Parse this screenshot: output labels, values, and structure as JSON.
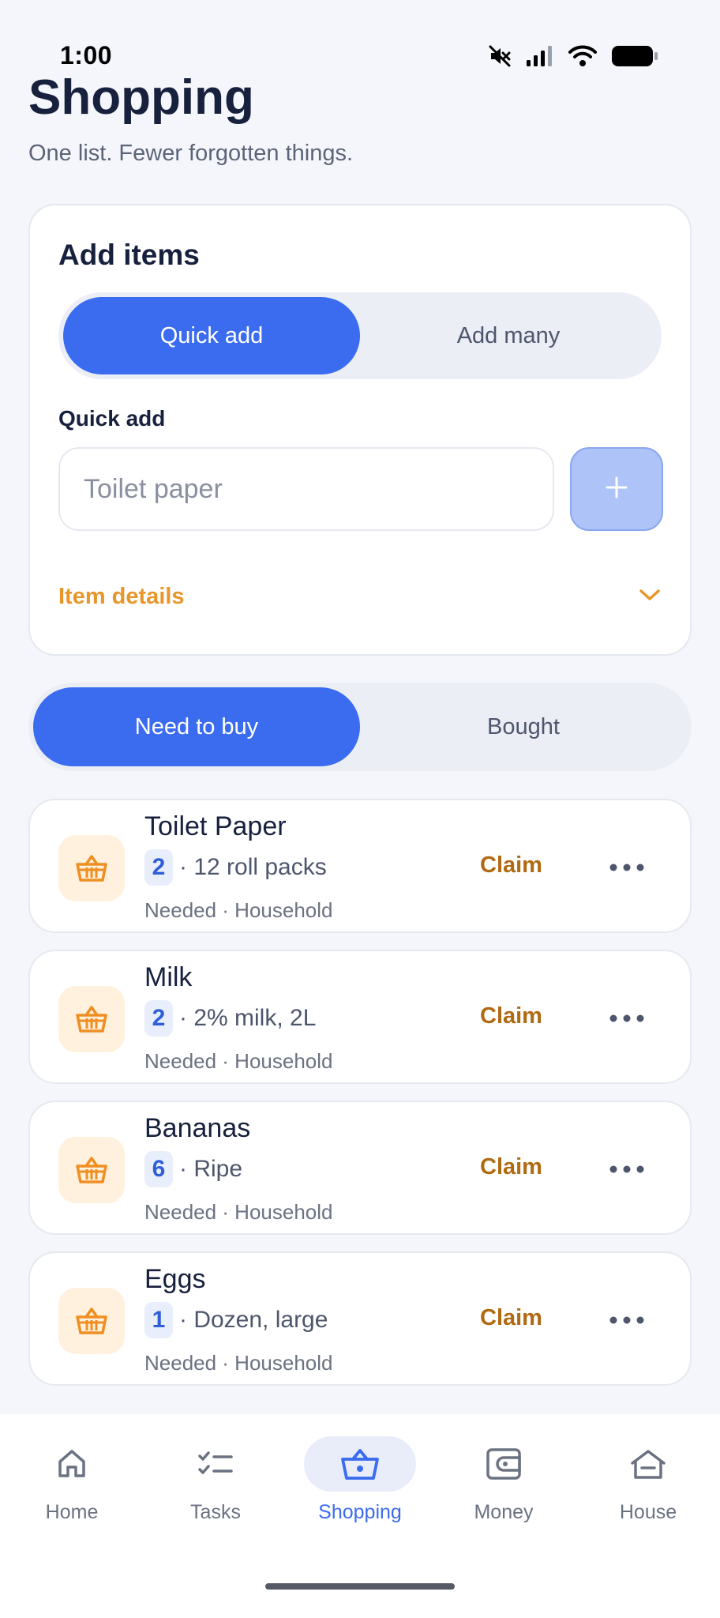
{
  "status_bar": {
    "time": "1:00"
  },
  "header": {
    "title": "Shopping",
    "subtitle": "One list. Fewer forgotten things."
  },
  "add_items": {
    "title": "Add items",
    "mode_tabs": [
      {
        "label": "Quick add",
        "active": true
      },
      {
        "label": "Add many",
        "active": false
      }
    ],
    "field_label": "Quick add",
    "input_value": "",
    "input_placeholder": "Toilet paper",
    "add_button_icon": "plus-icon",
    "details_label": "Item details"
  },
  "filter_tabs": [
    {
      "label": "Need to buy",
      "active": true
    },
    {
      "label": "Bought",
      "active": false
    }
  ],
  "items": [
    {
      "name": "Toilet Paper",
      "qty": "2",
      "detail": "· 12 roll packs",
      "meta": "Needed · Household",
      "action": "Claim"
    },
    {
      "name": "Milk",
      "qty": "2",
      "detail": "· 2% milk, 2L",
      "meta": "Needed · Household",
      "action": "Claim"
    },
    {
      "name": "Bananas",
      "qty": "6",
      "detail": "· Ripe",
      "meta": "Needed · Household",
      "action": "Claim"
    },
    {
      "name": "Eggs",
      "qty": "1",
      "detail": "· Dozen, large",
      "meta": "Needed · Household",
      "action": "Claim"
    }
  ],
  "bottom_nav": [
    {
      "label": "Home",
      "icon": "home-icon",
      "active": false
    },
    {
      "label": "Tasks",
      "icon": "tasks-icon",
      "active": false
    },
    {
      "label": "Shopping",
      "icon": "basket-icon",
      "active": true
    },
    {
      "label": "Money",
      "icon": "wallet-icon",
      "active": false
    },
    {
      "label": "House",
      "icon": "house-icon",
      "active": false
    }
  ],
  "colors": {
    "accent": "#3b6cf0",
    "claim": "#b06a12",
    "details": "#e8962a",
    "basket": "#ef8f23"
  }
}
